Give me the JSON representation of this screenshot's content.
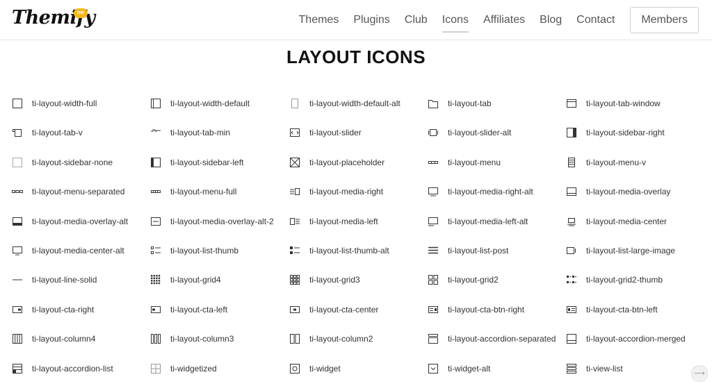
{
  "header": {
    "logo_text": "Themify",
    "logo_badge": "me",
    "nav": [
      {
        "label": "Themes",
        "name": "nav-themes"
      },
      {
        "label": "Plugins",
        "name": "nav-plugins"
      },
      {
        "label": "Club",
        "name": "nav-club"
      },
      {
        "label": "Icons",
        "name": "nav-icons",
        "active": true
      },
      {
        "label": "Affiliates",
        "name": "nav-affiliates"
      },
      {
        "label": "Blog",
        "name": "nav-blog"
      },
      {
        "label": "Contact",
        "name": "nav-contact"
      }
    ],
    "members_label": "Members"
  },
  "page_title": "LAYOUT ICONS",
  "icons": [
    [
      "ti-layout-width-full",
      "ti-layout-width-default",
      "ti-layout-width-default-alt",
      "ti-layout-tab",
      "ti-layout-tab-window"
    ],
    [
      "ti-layout-tab-v",
      "ti-layout-tab-min",
      "ti-layout-slider",
      "ti-layout-slider-alt",
      "ti-layout-sidebar-right"
    ],
    [
      "ti-layout-sidebar-none",
      "ti-layout-sidebar-left",
      "ti-layout-placeholder",
      "ti-layout-menu",
      "ti-layout-menu-v"
    ],
    [
      "ti-layout-menu-separated",
      "ti-layout-menu-full",
      "ti-layout-media-right",
      "ti-layout-media-right-alt",
      "ti-layout-media-overlay"
    ],
    [
      "ti-layout-media-overlay-alt",
      "ti-layout-media-overlay-alt-2",
      "ti-layout-media-left",
      "ti-layout-media-left-alt",
      "ti-layout-media-center"
    ],
    [
      "ti-layout-media-center-alt",
      "ti-layout-list-thumb",
      "ti-layout-list-thumb-alt",
      "ti-layout-list-post",
      "ti-layout-list-large-image"
    ],
    [
      "ti-layout-line-solid",
      "ti-layout-grid4",
      "ti-layout-grid3",
      "ti-layout-grid2",
      "ti-layout-grid2-thumb"
    ],
    [
      "ti-layout-cta-right",
      "ti-layout-cta-left",
      "ti-layout-cta-center",
      "ti-layout-cta-btn-right",
      "ti-layout-cta-btn-left"
    ],
    [
      "ti-layout-column4",
      "ti-layout-column3",
      "ti-layout-column2",
      "ti-layout-accordion-separated",
      "ti-layout-accordion-merged"
    ],
    [
      "ti-layout-accordion-list",
      "ti-widgetized",
      "ti-widget",
      "ti-widget-alt",
      "ti-view-list"
    ]
  ]
}
